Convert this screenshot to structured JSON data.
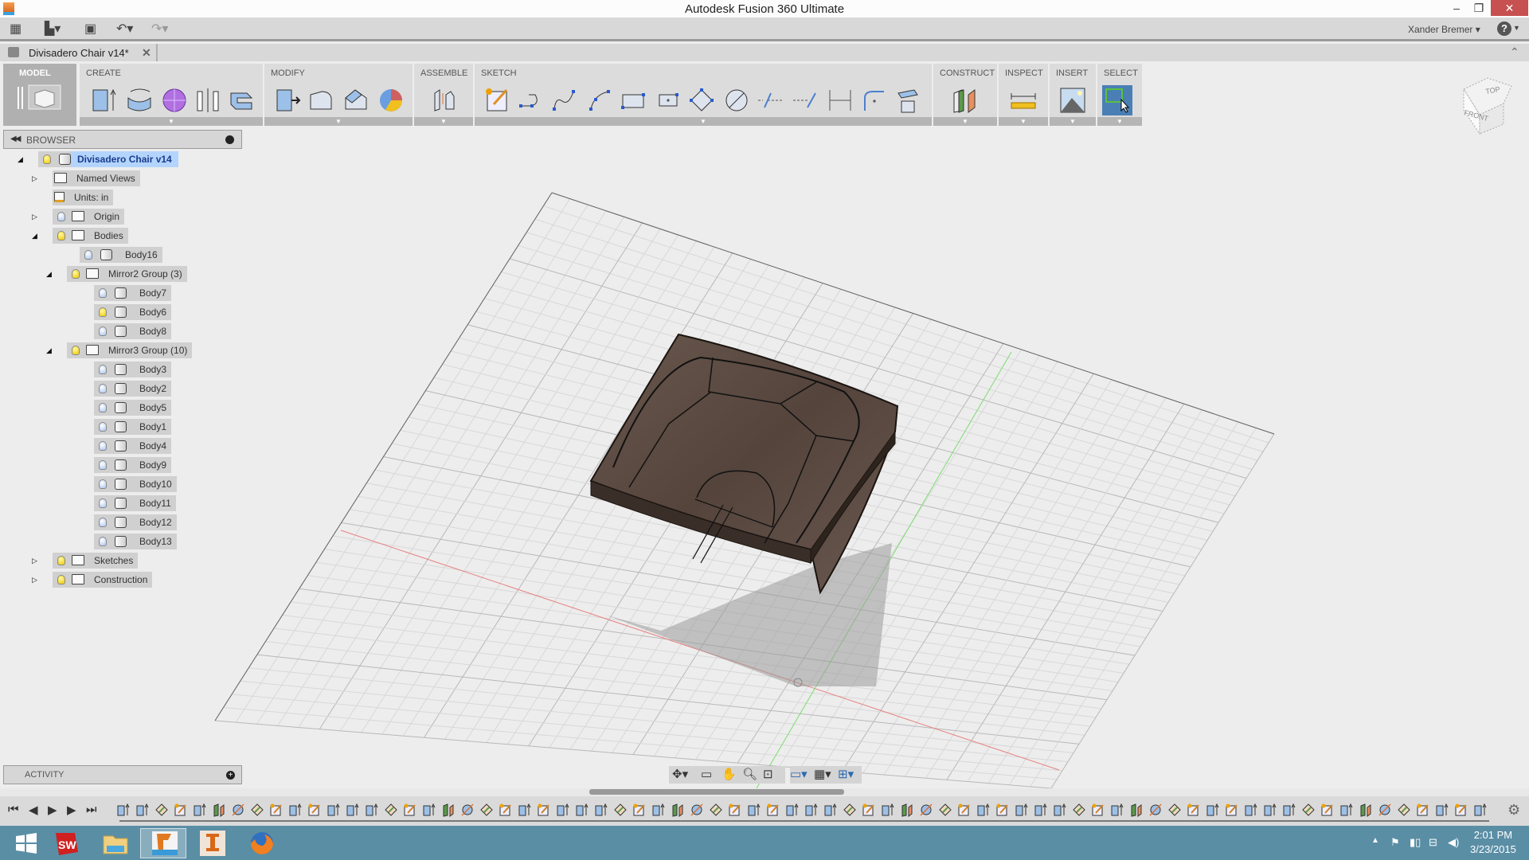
{
  "window": {
    "title": "Autodesk Fusion 360 Ultimate",
    "minimize": "–",
    "restore": "❐",
    "close": "✕"
  },
  "quick_access": {
    "grid_icon": "grid-icon",
    "file_icon": "file-icon",
    "save_icon": "save-icon",
    "undo_icon": "undo-icon",
    "redo_icon": "redo-icon",
    "user": "Xander Bremer",
    "help": "?"
  },
  "document_tab": {
    "label": "Divisadero Chair v14*",
    "close": "✕"
  },
  "ribbon": {
    "workspace": "MODEL",
    "panels": [
      {
        "label": "CREATE",
        "tools": [
          "extrude",
          "revolve",
          "sphere",
          "mirror",
          "pattern"
        ]
      },
      {
        "label": "MODIFY",
        "tools": [
          "press-pull",
          "fillet",
          "chamfer",
          "appearance"
        ]
      },
      {
        "label": "ASSEMBLE",
        "tools": [
          "joint"
        ]
      },
      {
        "label": "SKETCH",
        "tools": [
          "create-sketch",
          "line",
          "spline",
          "arc",
          "rectangle",
          "center-rectangle",
          "polygon",
          "circle",
          "project",
          "offset",
          "dimension",
          "fillet",
          "stop-sketch"
        ]
      },
      {
        "label": "CONSTRUCT",
        "tools": [
          "offset-plane"
        ]
      },
      {
        "label": "INSPECT",
        "tools": [
          "measure"
        ]
      },
      {
        "label": "INSERT",
        "tools": [
          "insert-image"
        ]
      },
      {
        "label": "SELECT",
        "tools": [
          "window-select"
        ]
      }
    ]
  },
  "browser": {
    "title": "BROWSER",
    "root": "Divisadero Chair v14",
    "items": [
      {
        "label": "Named Views",
        "type": "folder",
        "expand": "collapsed",
        "light": null
      },
      {
        "label": "Units: in",
        "type": "doc",
        "expand": null,
        "light": null
      },
      {
        "label": "Origin",
        "type": "folder",
        "expand": "collapsed",
        "light": "off"
      },
      {
        "label": "Bodies",
        "type": "folder",
        "expand": "expanded",
        "light": "on"
      },
      {
        "label": "Body16",
        "type": "body",
        "light": "off"
      },
      {
        "label": "Mirror2 Group (3)",
        "type": "folder",
        "expand": "expanded",
        "light": "on"
      },
      {
        "label": "Body7",
        "type": "body",
        "light": "off"
      },
      {
        "label": "Body6",
        "type": "body",
        "light": "on"
      },
      {
        "label": "Body8",
        "type": "body",
        "light": "off"
      },
      {
        "label": "Mirror3 Group (10)",
        "type": "folder",
        "expand": "expanded",
        "light": "on"
      },
      {
        "label": "Body3",
        "type": "body",
        "light": "off"
      },
      {
        "label": "Body2",
        "type": "body",
        "light": "off"
      },
      {
        "label": "Body5",
        "type": "body",
        "light": "off"
      },
      {
        "label": "Body1",
        "type": "body",
        "light": "off"
      },
      {
        "label": "Body4",
        "type": "body",
        "light": "off"
      },
      {
        "label": "Body9",
        "type": "body",
        "light": "off"
      },
      {
        "label": "Body10",
        "type": "body",
        "light": "off"
      },
      {
        "label": "Body11",
        "type": "body",
        "light": "off"
      },
      {
        "label": "Body12",
        "type": "body",
        "light": "off"
      },
      {
        "label": "Body13",
        "type": "body",
        "light": "off"
      },
      {
        "label": "Sketches",
        "type": "folder",
        "expand": "collapsed",
        "light": "on"
      },
      {
        "label": "Construction",
        "type": "folder",
        "expand": "collapsed",
        "light": "on"
      }
    ]
  },
  "activity": {
    "title": "ACTIVITY"
  },
  "viewcube": {
    "top": "TOP",
    "front": "FRONT"
  },
  "navbar": [
    "orbit",
    "look-at",
    "pan",
    "zoom",
    "fit",
    "display-settings",
    "grid-settings",
    "viewports"
  ],
  "timeline": {
    "playback": [
      "⏮",
      "◀",
      "▶",
      "▶",
      "⏭"
    ],
    "feature_count": 72
  },
  "taskbar": {
    "apps": [
      "windows-start",
      "solidworks",
      "file-explorer",
      "fusion-360",
      "inventor-pro",
      "firefox"
    ],
    "time": "2:01 PM",
    "date": "3/23/2015"
  },
  "colors": {
    "accent_select": "#4a7fb5",
    "wood": "#5a4a42",
    "close": "#c75050",
    "taskbar": "#5a8ea5"
  }
}
